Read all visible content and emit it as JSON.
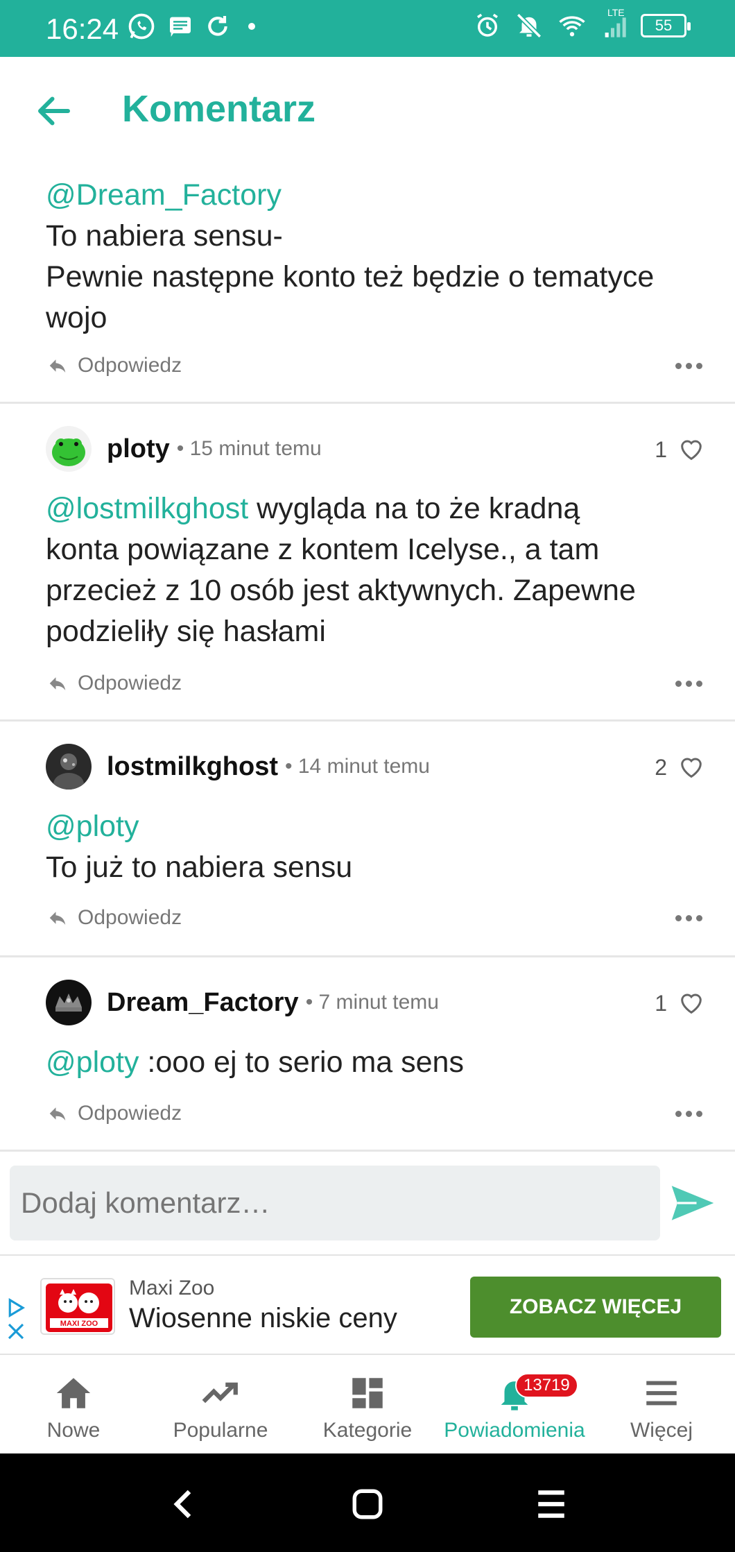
{
  "status_bar": {
    "time": "16:24",
    "battery": "55",
    "network": "LTE"
  },
  "header": {
    "title": "Komentarz"
  },
  "comments": [
    {
      "mention": "@Dream_Factory",
      "text_lines": [
        "To nabiera sensu-",
        "Pewnie następne konto też będzie o tematyce",
        "wojo"
      ],
      "reply": "Odpowiedz"
    },
    {
      "user": "ploty",
      "time": "15 minut temu",
      "likes": "1",
      "mention": "@lostmilkghost",
      "text_lines": [
        " wygląda na to że kradną",
        "konta powiązane z kontem Icelyse., a tam",
        "przecież z 10 osób jest aktywnych. Zapewne",
        "podzieliły się hasłami"
      ],
      "reply": "Odpowiedz"
    },
    {
      "user": "lostmilkghost",
      "time": "14 minut temu",
      "likes": "2",
      "mention": "@ploty",
      "text_lines": [
        "To już to nabiera sensu"
      ],
      "reply": "Odpowiedz"
    },
    {
      "user": "Dream_Factory",
      "time": "7 minut temu",
      "likes": "1",
      "mention": "@ploty",
      "text_lines": [
        " :ooo ej to serio ma sens"
      ],
      "reply": "Odpowiedz"
    }
  ],
  "composer": {
    "placeholder": "Dodaj komentarz…"
  },
  "ad": {
    "brand": "Maxi Zoo",
    "title": "Wiosenne niskie ceny",
    "cta": "ZOBACZ WIĘCEJ",
    "logo_text": "MAXI ZOO"
  },
  "bottom_nav": {
    "items": [
      {
        "label": "Nowe"
      },
      {
        "label": "Popularne"
      },
      {
        "label": "Kategorie"
      },
      {
        "label": "Powiadomienia",
        "badge": "13719"
      },
      {
        "label": "Więcej"
      }
    ]
  },
  "colors": {
    "accent": "#22b19b",
    "ad_cta": "#4d8e2d",
    "badge": "#e0141e"
  }
}
